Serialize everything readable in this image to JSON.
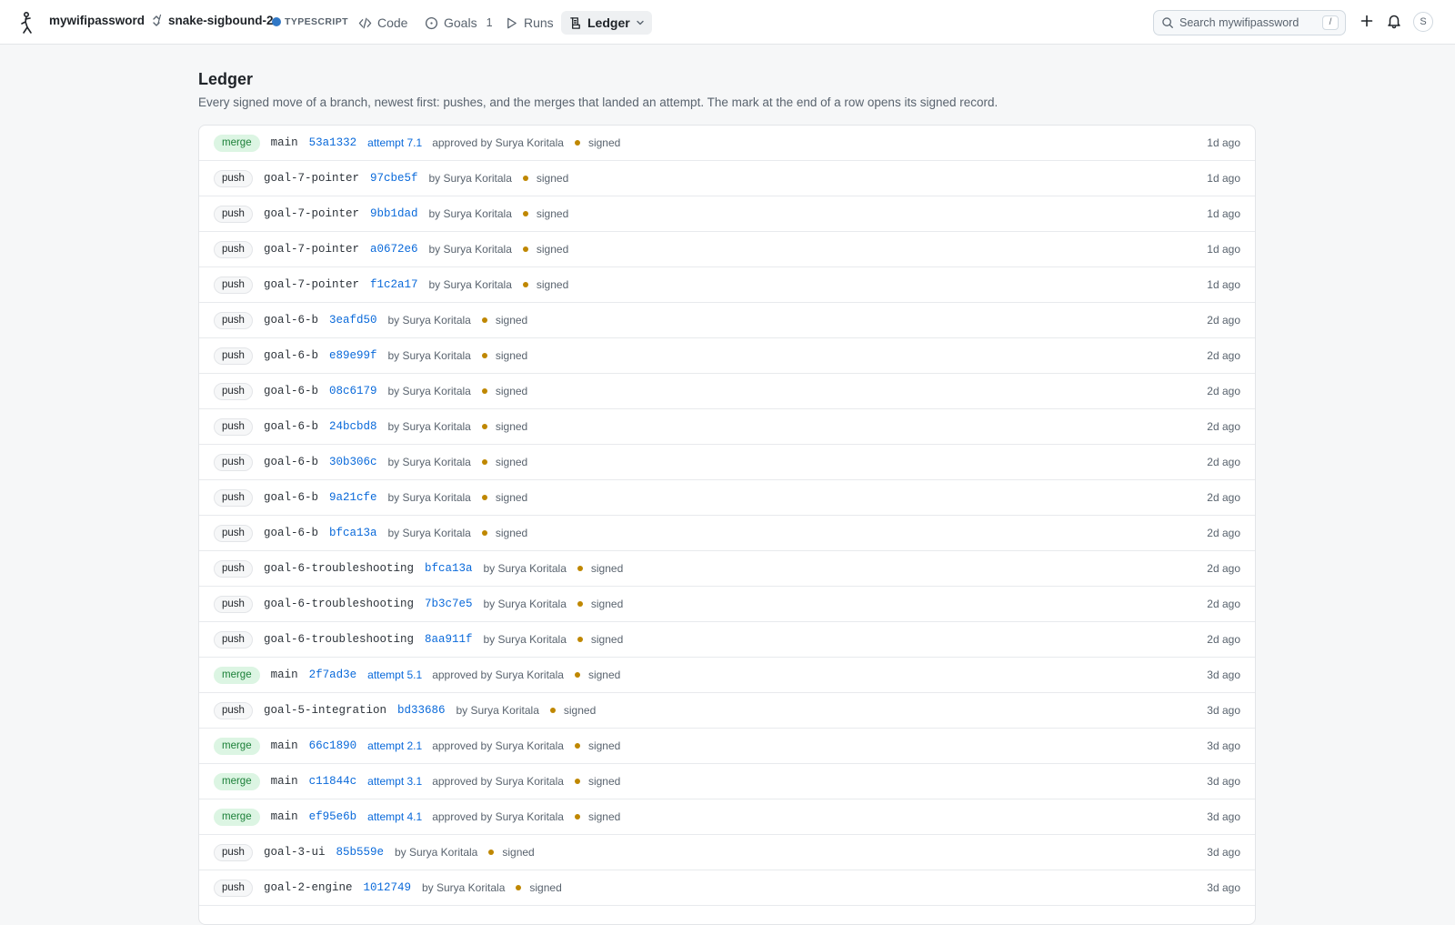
{
  "header": {
    "org_name": "mywifipassword",
    "repo_name": "snake-sigbound-2",
    "repo_language": "TYPESCRIPT",
    "language_color": "#3178c6",
    "nav": {
      "code": "Code",
      "goals": "Goals",
      "goals_count": "1",
      "runs": "Runs",
      "ledger": "Ledger"
    },
    "search_placeholder": "Search mywifipassword",
    "search_shortcut": "/",
    "avatar_initial": "S",
    "icons": [
      "logo-icon",
      "chevron-updown-icon",
      "code-icon",
      "goal-icon",
      "play-icon",
      "ledger-icon",
      "chevron-down-icon",
      "search-icon",
      "plus-icon",
      "bell-icon"
    ]
  },
  "page": {
    "title": "Ledger",
    "description": "Every signed move of a branch, newest first: pushes, and the merges that landed an attempt. The mark at the end of a row opens its signed record."
  },
  "colors": {
    "merge_badge_bg": "#dcf5e3",
    "merge_badge_text": "#1a7f37",
    "link": "#0969da",
    "signed_dot": "#bf8700"
  },
  "ledger": [
    {
      "kind": "merge",
      "branch": "main",
      "sha": "53a1332",
      "attempt": "attempt 7.1",
      "by": "approved by Surya Koritala",
      "status": "signed",
      "when": "1d ago"
    },
    {
      "kind": "push",
      "branch": "goal-7-pointer",
      "sha": "97cbe5f",
      "attempt": "",
      "by": "by Surya Koritala",
      "status": "signed",
      "when": "1d ago"
    },
    {
      "kind": "push",
      "branch": "goal-7-pointer",
      "sha": "9bb1dad",
      "attempt": "",
      "by": "by Surya Koritala",
      "status": "signed",
      "when": "1d ago"
    },
    {
      "kind": "push",
      "branch": "goal-7-pointer",
      "sha": "a0672e6",
      "attempt": "",
      "by": "by Surya Koritala",
      "status": "signed",
      "when": "1d ago"
    },
    {
      "kind": "push",
      "branch": "goal-7-pointer",
      "sha": "f1c2a17",
      "attempt": "",
      "by": "by Surya Koritala",
      "status": "signed",
      "when": "1d ago"
    },
    {
      "kind": "push",
      "branch": "goal-6-b",
      "sha": "3eafd50",
      "attempt": "",
      "by": "by Surya Koritala",
      "status": "signed",
      "when": "2d ago"
    },
    {
      "kind": "push",
      "branch": "goal-6-b",
      "sha": "e89e99f",
      "attempt": "",
      "by": "by Surya Koritala",
      "status": "signed",
      "when": "2d ago"
    },
    {
      "kind": "push",
      "branch": "goal-6-b",
      "sha": "08c6179",
      "attempt": "",
      "by": "by Surya Koritala",
      "status": "signed",
      "when": "2d ago"
    },
    {
      "kind": "push",
      "branch": "goal-6-b",
      "sha": "24bcbd8",
      "attempt": "",
      "by": "by Surya Koritala",
      "status": "signed",
      "when": "2d ago"
    },
    {
      "kind": "push",
      "branch": "goal-6-b",
      "sha": "30b306c",
      "attempt": "",
      "by": "by Surya Koritala",
      "status": "signed",
      "when": "2d ago"
    },
    {
      "kind": "push",
      "branch": "goal-6-b",
      "sha": "9a21cfe",
      "attempt": "",
      "by": "by Surya Koritala",
      "status": "signed",
      "when": "2d ago"
    },
    {
      "kind": "push",
      "branch": "goal-6-b",
      "sha": "bfca13a",
      "attempt": "",
      "by": "by Surya Koritala",
      "status": "signed",
      "when": "2d ago"
    },
    {
      "kind": "push",
      "branch": "goal-6-troubleshooting",
      "sha": "bfca13a",
      "attempt": "",
      "by": "by Surya Koritala",
      "status": "signed",
      "when": "2d ago"
    },
    {
      "kind": "push",
      "branch": "goal-6-troubleshooting",
      "sha": "7b3c7e5",
      "attempt": "",
      "by": "by Surya Koritala",
      "status": "signed",
      "when": "2d ago"
    },
    {
      "kind": "push",
      "branch": "goal-6-troubleshooting",
      "sha": "8aa911f",
      "attempt": "",
      "by": "by Surya Koritala",
      "status": "signed",
      "when": "2d ago"
    },
    {
      "kind": "merge",
      "branch": "main",
      "sha": "2f7ad3e",
      "attempt": "attempt 5.1",
      "by": "approved by Surya Koritala",
      "status": "signed",
      "when": "3d ago"
    },
    {
      "kind": "push",
      "branch": "goal-5-integration",
      "sha": "bd33686",
      "attempt": "",
      "by": "by Surya Koritala",
      "status": "signed",
      "when": "3d ago"
    },
    {
      "kind": "merge",
      "branch": "main",
      "sha": "66c1890",
      "attempt": "attempt 2.1",
      "by": "approved by Surya Koritala",
      "status": "signed",
      "when": "3d ago"
    },
    {
      "kind": "merge",
      "branch": "main",
      "sha": "c11844c",
      "attempt": "attempt 3.1",
      "by": "approved by Surya Koritala",
      "status": "signed",
      "when": "3d ago"
    },
    {
      "kind": "merge",
      "branch": "main",
      "sha": "ef95e6b",
      "attempt": "attempt 4.1",
      "by": "approved by Surya Koritala",
      "status": "signed",
      "when": "3d ago"
    },
    {
      "kind": "push",
      "branch": "goal-3-ui",
      "sha": "85b559e",
      "attempt": "",
      "by": "by Surya Koritala",
      "status": "signed",
      "when": "3d ago"
    },
    {
      "kind": "push",
      "branch": "goal-2-engine",
      "sha": "1012749",
      "attempt": "",
      "by": "by Surya Koritala",
      "status": "signed",
      "when": "3d ago"
    }
  ]
}
